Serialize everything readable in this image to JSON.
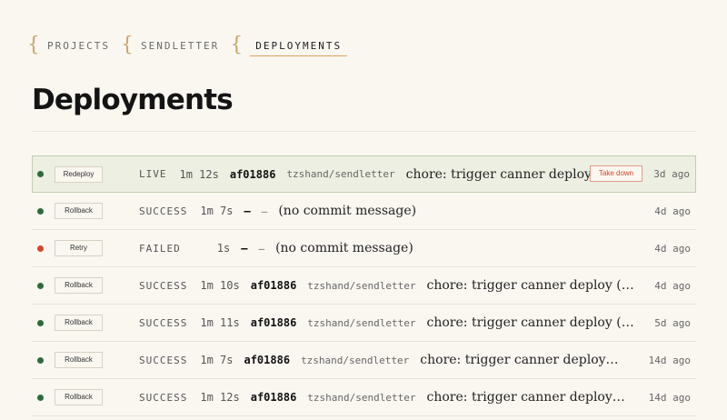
{
  "breadcrumb": [
    "PROJECTS",
    "SENDLETTER",
    "DEPLOYMENTS"
  ],
  "page_title": "Deployments",
  "takedown_label": "Take down",
  "colors": {
    "accent": "#d8a05a",
    "success": "#2e6b3a",
    "failed": "#d9452f",
    "live_bg": "#ecefe2"
  },
  "deployments": [
    {
      "dot": "green",
      "action": "Redeploy",
      "status": "LIVE",
      "duration": "1m 12s",
      "commit": "af01886",
      "repo": "tzshand/sendletter",
      "message": "chore: trigger canner deploy",
      "age": "3d ago"
    },
    {
      "dot": "green",
      "action": "Rollback",
      "status": "SUCCESS",
      "duration": "1m 7s",
      "commit": "—",
      "repo": "—",
      "message": "(no commit message)",
      "age": "4d ago"
    },
    {
      "dot": "red",
      "action": "Retry",
      "status": "FAILED",
      "duration": "1s",
      "commit": "—",
      "repo": "—",
      "message": "(no commit message)",
      "age": "4d ago"
    },
    {
      "dot": "green",
      "action": "Rollback",
      "status": "SUCCESS",
      "duration": "1m 10s",
      "commit": "af01886",
      "repo": "tzshand/sendletter",
      "message": "chore: trigger canner deploy (env va...",
      "age": "4d ago"
    },
    {
      "dot": "green",
      "action": "Rollback",
      "status": "SUCCESS",
      "duration": "1m 11s",
      "commit": "af01886",
      "repo": "tzshand/sendletter",
      "message": "chore: trigger canner deploy (env va...",
      "age": "5d ago"
    },
    {
      "dot": "green",
      "action": "Rollback",
      "status": "SUCCESS",
      "duration": "1m 7s",
      "commit": "af01886",
      "repo": "tzshand/sendletter",
      "message": "chore: trigger canner deploy (env v...",
      "age": "14d ago"
    },
    {
      "dot": "green",
      "action": "Rollback",
      "status": "SUCCESS",
      "duration": "1m 12s",
      "commit": "af01886",
      "repo": "tzshand/sendletter",
      "message": "chore: trigger canner deploy (env v...",
      "age": "14d ago"
    }
  ]
}
